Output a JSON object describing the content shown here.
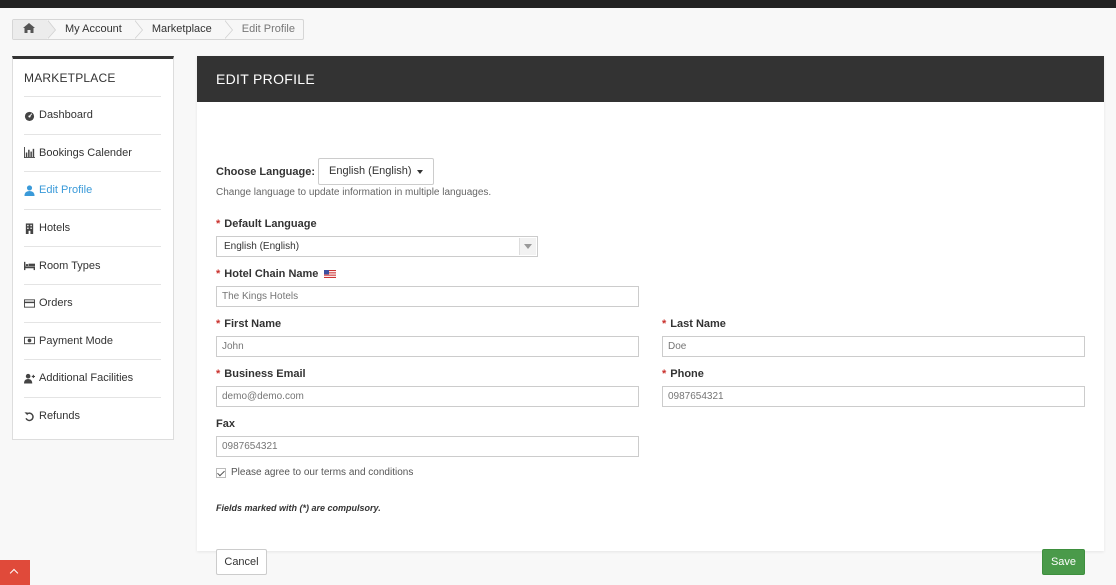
{
  "breadcrumb": {
    "home_icon": "home-icon",
    "items": [
      "My Account",
      "Marketplace",
      "Edit Profile"
    ]
  },
  "sidebar": {
    "title": "MARKETPLACE",
    "items": [
      {
        "label": "Dashboard",
        "icon": "dashboard-icon"
      },
      {
        "label": "Bookings Calender",
        "icon": "bar-chart-icon"
      },
      {
        "label": "Edit Profile",
        "icon": "user-icon",
        "active": true
      },
      {
        "label": "Hotels",
        "icon": "building-icon"
      },
      {
        "label": "Room Types",
        "icon": "bed-icon"
      },
      {
        "label": "Orders",
        "icon": "credit-card-icon"
      },
      {
        "label": "Payment Mode",
        "icon": "money-icon"
      },
      {
        "label": "Additional Facilities",
        "icon": "user-plus-icon"
      },
      {
        "label": "Refunds",
        "icon": "undo-icon"
      }
    ]
  },
  "panel": {
    "title": "EDIT PROFILE",
    "choose_language_label": "Choose Language:",
    "choose_language_value": "English (English)",
    "language_help": "Change language to update information in multiple languages.",
    "required_marker": "*",
    "fields": {
      "default_language": {
        "label": "Default Language",
        "value": "English (English)"
      },
      "hotel_chain_name": {
        "label": "Hotel Chain Name",
        "placeholder": "The Kings Hotels",
        "flag_icon": "us-flag-icon"
      },
      "first_name": {
        "label": "First Name",
        "placeholder": "John"
      },
      "last_name": {
        "label": "Last Name",
        "placeholder": "Doe"
      },
      "business_email": {
        "label": "Business Email",
        "placeholder": "demo@demo.com"
      },
      "phone": {
        "label": "Phone",
        "placeholder": "0987654321"
      },
      "fax": {
        "label": "Fax",
        "placeholder": "0987654321"
      }
    },
    "terms_label": "Please agree to our terms and conditions",
    "terms_checked": true,
    "compulsory_note": "Fields marked with (*) are compulsory.",
    "cancel_label": "Cancel",
    "save_label": "Save"
  },
  "colors": {
    "header_bg": "#333333",
    "active_link": "#3a9ad9",
    "required": "#c9302c",
    "save_button": "#4a9a4a",
    "scroll_top_button": "#e04a3a"
  }
}
